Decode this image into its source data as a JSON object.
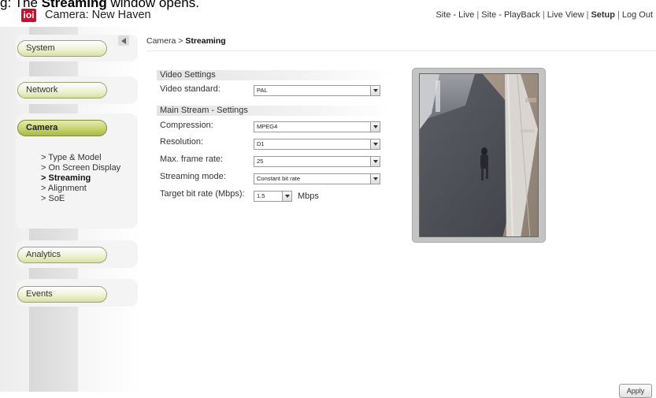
{
  "caption": {
    "prefix": "g",
    "bold_word": "Streaming",
    "suffix": " window opens."
  },
  "header": {
    "logo_text": "ioi",
    "title": "Camera: New Haven",
    "nav": [
      "Site - Live",
      "Site - PlayBack",
      "Live View",
      "Setup",
      "Log Out"
    ],
    "current_nav": "Setup"
  },
  "sidebar": {
    "items": [
      {
        "label": "System"
      },
      {
        "label": "Network"
      },
      {
        "label": "Camera"
      },
      {
        "label": "Analytics"
      },
      {
        "label": "Events"
      }
    ],
    "active": "Camera",
    "sub_items": [
      {
        "label": "> Type & Model"
      },
      {
        "label": "> On Screen Display"
      },
      {
        "label": "> Streaming"
      },
      {
        "label": "> Alignment"
      },
      {
        "label": "> SoE"
      }
    ],
    "active_sub": "> Streaming"
  },
  "breadcrumb": {
    "root": "Camera",
    "separator": " > ",
    "current": "Streaming"
  },
  "video_settings": {
    "heading": "Video Settings",
    "video_standard_label": "Video standard:",
    "video_standard_value": "PAL"
  },
  "main_stream": {
    "heading": "Main Stream - Settings",
    "compression_label": "Compression:",
    "compression_value": "MPEG4",
    "resolution_label": "Resolution:",
    "resolution_value": "D1",
    "frame_rate_label": "Max. frame rate:",
    "frame_rate_value": "25",
    "streaming_mode_label": "Streaming mode:",
    "streaming_mode_value": "Constant bit rate",
    "bitrate_label": "Target bit rate (Mbps):",
    "bitrate_value": "1.5",
    "bitrate_unit": "Mbps"
  },
  "actions": {
    "apply_label": "Apply"
  },
  "colors": {
    "logo_red": "#c8102e",
    "pill_green": "#c4d06a",
    "panel_grey": "#f4f4f4"
  }
}
